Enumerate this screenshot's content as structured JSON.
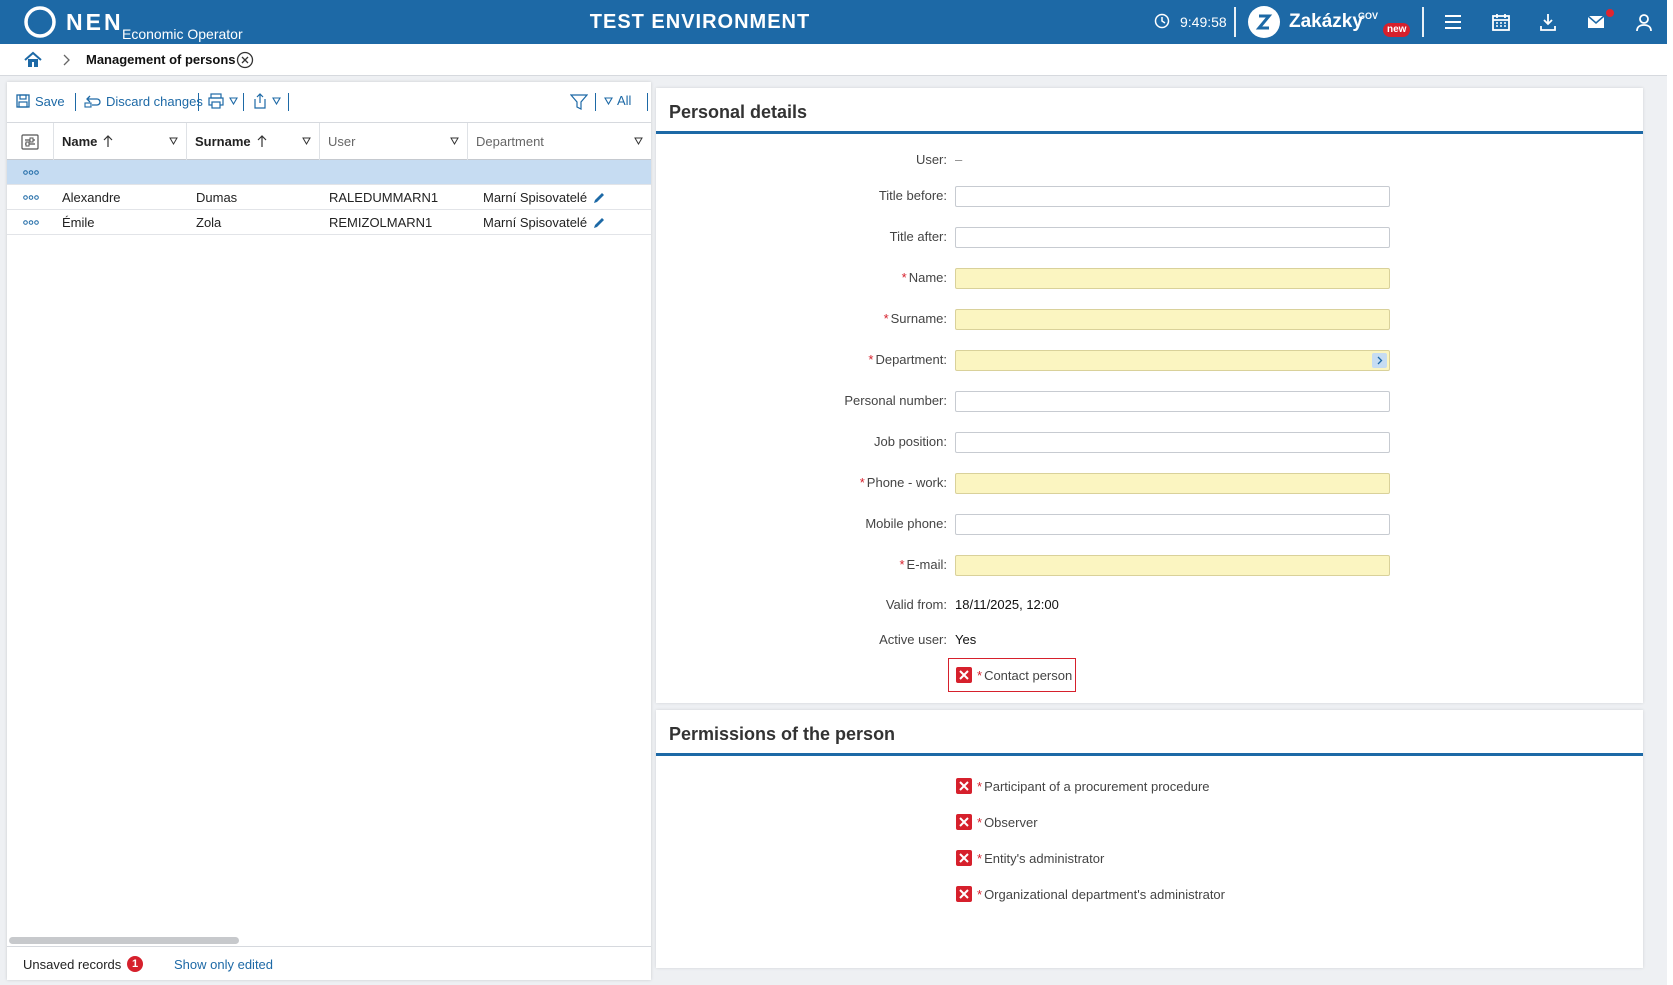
{
  "header": {
    "logo_text": "NEN",
    "logo_subtitle": "Economic Operator",
    "environment": "TEST ENVIRONMENT",
    "clock": "9:49:58",
    "portal_name": "Zakázky",
    "portal_sup": "GOV",
    "portal_badge": "new"
  },
  "breadcrumb": {
    "title": "Management of persons"
  },
  "toolbar": {
    "save": "Save",
    "discard": "Discard changes",
    "filter_all": "All"
  },
  "grid": {
    "columns": [
      "Name",
      "Surname",
      "User",
      "Department"
    ],
    "rows": [
      {
        "name": "",
        "surname": "",
        "user": "",
        "department": ""
      },
      {
        "name": "Alexandre",
        "surname": "Dumas",
        "user": "RALEDUMMARN1",
        "department": "Marní Spisovatelé"
      },
      {
        "name": "Émile",
        "surname": "Zola",
        "user": "REMIZOLMARN1",
        "department": "Marní Spisovatelé"
      }
    ]
  },
  "footer": {
    "unsaved_label": "Unsaved records",
    "unsaved_count": "1",
    "show_edited": "Show only edited"
  },
  "personal": {
    "title": "Personal details",
    "user_label": "User:",
    "user_value": "–",
    "title_before": "Title before:",
    "title_after": "Title after:",
    "name": "Name:",
    "surname": "Surname:",
    "department": "Department:",
    "personal_number": "Personal number:",
    "job_position": "Job position:",
    "phone_work": "Phone - work:",
    "mobile_phone": "Mobile phone:",
    "email": "E-mail:",
    "valid_from_label": "Valid from:",
    "valid_from_value": "18/11/2025, 12:00",
    "active_user_label": "Active user:",
    "active_user_value": "Yes",
    "contact_person": "Contact person"
  },
  "permissions": {
    "title": "Permissions of the person",
    "items": [
      "Participant of a procurement procedure",
      "Observer",
      "Entity's administrator",
      "Organizational department's administrator"
    ]
  },
  "colors": {
    "brand": "#1d69a6",
    "required_bg": "#fbf5c1",
    "error": "#d6202c",
    "selected_row": "#c6dcf2"
  }
}
